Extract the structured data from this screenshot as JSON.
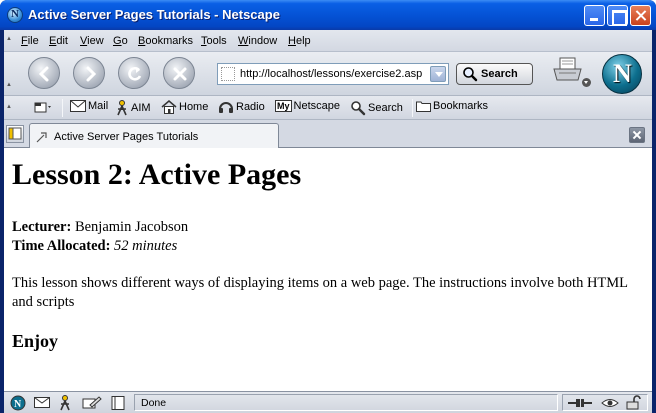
{
  "window": {
    "title": "Active Server Pages Tutorials - Netscape"
  },
  "menubar": {
    "items": [
      {
        "label": "File",
        "accel": "F",
        "rest": "ile"
      },
      {
        "label": "Edit",
        "accel": "E",
        "rest": "dit"
      },
      {
        "label": "View",
        "accel": "V",
        "rest": "iew"
      },
      {
        "label": "Go",
        "accel": "G",
        "rest": "o"
      },
      {
        "label": "Bookmarks",
        "accel": "B",
        "rest": "ookmarks"
      },
      {
        "label": "Tools",
        "accel": "T",
        "rest": "ools"
      },
      {
        "label": "Window",
        "accel": "W",
        "rest": "indow"
      },
      {
        "label": "Help",
        "accel": "H",
        "rest": "elp"
      }
    ]
  },
  "navbar": {
    "url": "http://localhost/lessons/exercise2.asp",
    "search_label": "Search"
  },
  "personalbar": {
    "items": [
      {
        "label": "Mail",
        "icon": "mail-icon"
      },
      {
        "label": "AIM",
        "icon": "aim-icon"
      },
      {
        "label": "Home",
        "icon": "home-icon"
      },
      {
        "label": "Radio",
        "icon": "radio-icon"
      },
      {
        "label": "Netscape",
        "icon": "my-netscape-icon",
        "badge": "My"
      },
      {
        "label": "Search",
        "icon": "search-icon"
      },
      {
        "label": "Bookmarks",
        "icon": "bookmarks-folder-icon"
      }
    ]
  },
  "tabs": {
    "active_label": "Active Server Pages Tutorials"
  },
  "content": {
    "heading": "Lesson 2: Active Pages",
    "lecturer_label": "Lecturer:",
    "lecturer_value": "Benjamin Jacobson",
    "time_label": "Time Allocated:",
    "time_value": "52 minutes",
    "paragraph": "This lesson shows different ways of displaying items on a web page. The instructions involve both HTML and scripts",
    "closing": "Enjoy"
  },
  "statusbar": {
    "text": "Done"
  },
  "colors": {
    "titlebar": "#0553d6",
    "chrome": "#d4d9e3",
    "netscape_teal": "#0d6f8e"
  }
}
